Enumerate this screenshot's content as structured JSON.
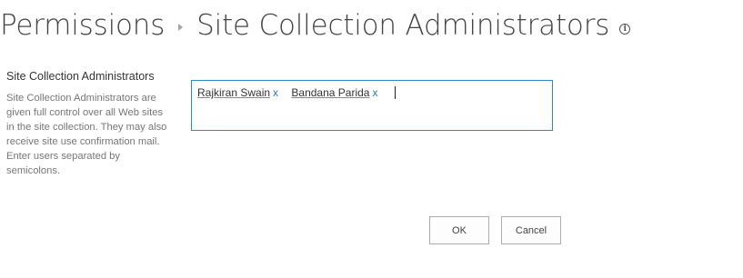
{
  "breadcrumb": {
    "parent": "Permissions",
    "current": "Site Collection Administrators",
    "info_icon": "info-circle-icon"
  },
  "section": {
    "heading": "Site Collection Administrators",
    "description": "Site Collection Administrators are given full control over all Web sites in the site collection. They may also receive site use confirmation mail. Enter users separated by semicolons."
  },
  "people_picker": {
    "entries": [
      {
        "name": "Rajkiran Swain",
        "remove": "x"
      },
      {
        "name": "Bandana Parida",
        "remove": "x"
      }
    ],
    "border_color": "#2f8ac2"
  },
  "buttons": {
    "ok_label": "OK",
    "cancel_label": "Cancel"
  }
}
